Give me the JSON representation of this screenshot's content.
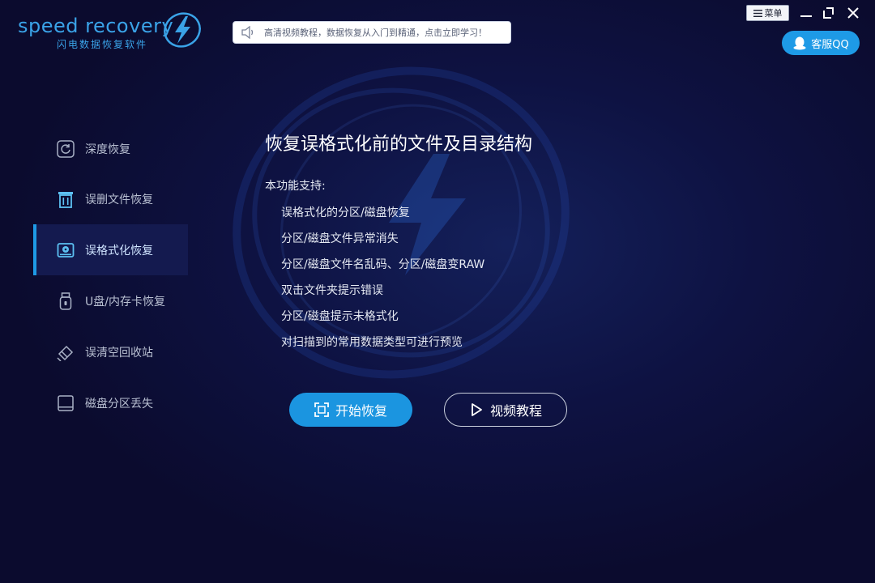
{
  "brand": {
    "name": "speed recovery",
    "subtitle": "闪电数据恢复软件",
    "accent": "#3aa3e8"
  },
  "header": {
    "notice_text": "高清视频教程，数据恢复从入门到精通，点击立即学习！",
    "menu_label": "菜单",
    "qq_label": "客服QQ"
  },
  "sidebar": {
    "items": [
      {
        "label": "深度恢复",
        "icon": "deep-scan-icon",
        "active": false
      },
      {
        "label": "误删文件恢复",
        "icon": "trash-icon",
        "active": false
      },
      {
        "label": "误格式化恢复",
        "icon": "disk-format-icon",
        "active": true
      },
      {
        "label": "U盘/内存卡恢复",
        "icon": "usb-icon",
        "active": false
      },
      {
        "label": "误清空回收站",
        "icon": "eraser-icon",
        "active": false
      },
      {
        "label": "磁盘分区丢失",
        "icon": "partition-icon",
        "active": false
      }
    ]
  },
  "main": {
    "title": "恢复误格式化前的文件及目录结构",
    "support_label": "本功能支持:",
    "features": [
      "误格式化的分区/磁盘恢复",
      "分区/磁盘文件异常消失",
      "分区/磁盘文件名乱码、分区/磁盘变RAW",
      "双击文件夹提示错误",
      "分区/磁盘提示未格式化",
      "对扫描到的常用数据类型可进行预览"
    ],
    "start_label": "开始恢复",
    "video_label": "视频教程"
  },
  "colors": {
    "background": "#0b0b2e",
    "primary_button": "#1b95e0",
    "active_nav": "#141a4f"
  }
}
